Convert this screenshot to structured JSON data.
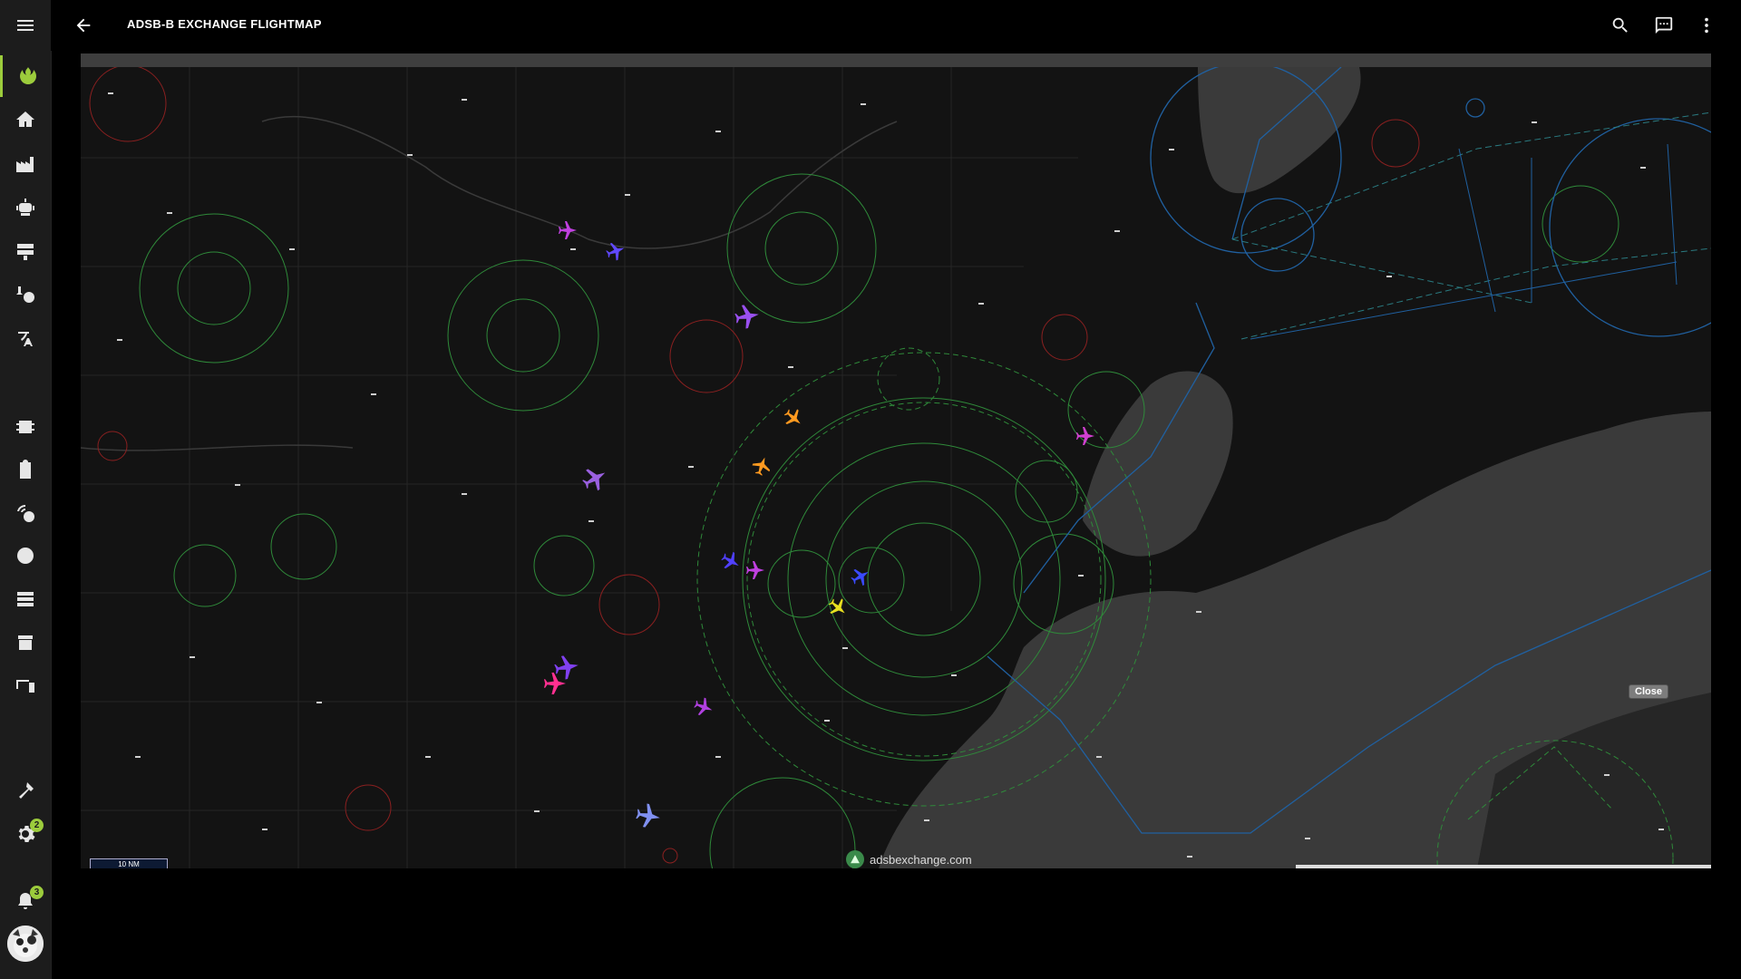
{
  "app": {
    "title": "ADSB-B EXCHANGE FLIGHTMAP"
  },
  "sidebar": {
    "items": [
      {
        "icon": "menu-icon"
      },
      {
        "icon": "rebel-logo-icon",
        "active": true
      },
      {
        "icon": "home-icon"
      },
      {
        "icon": "factory-icon"
      },
      {
        "icon": "robot-icon"
      },
      {
        "icon": "server-rack-icon"
      },
      {
        "icon": "tools-clock-icon"
      },
      {
        "icon": "translate-icon"
      },
      {
        "icon": "memory-chip-icon"
      },
      {
        "icon": "clipboard-icon"
      },
      {
        "icon": "radar-signal-icon"
      },
      {
        "icon": "globe-icon"
      },
      {
        "icon": "database-icon"
      },
      {
        "icon": "hacs-store-icon"
      },
      {
        "icon": "devices-icon"
      },
      {
        "icon": "hammer-icon"
      },
      {
        "icon": "settings-icon",
        "badge": "2"
      },
      {
        "icon": "bell-icon",
        "badge": "3"
      }
    ],
    "accent_color": "#9ccc3c"
  },
  "toolbar": {
    "icons": [
      "search-icon",
      "chat-icon",
      "more-vert-icon"
    ]
  },
  "map": {
    "close_label": "Close",
    "watermark": "adsbexchange.com",
    "scale_label": "10 NM",
    "land_color": "#141414",
    "water_color": "#3a3a3a",
    "aircraft_colors": [
      "#c040e0",
      "#6048ff",
      "#9a50f0",
      "#ff9a20",
      "#ff3090",
      "#e8e020",
      "#3a4aff",
      "#8090f0"
    ]
  }
}
